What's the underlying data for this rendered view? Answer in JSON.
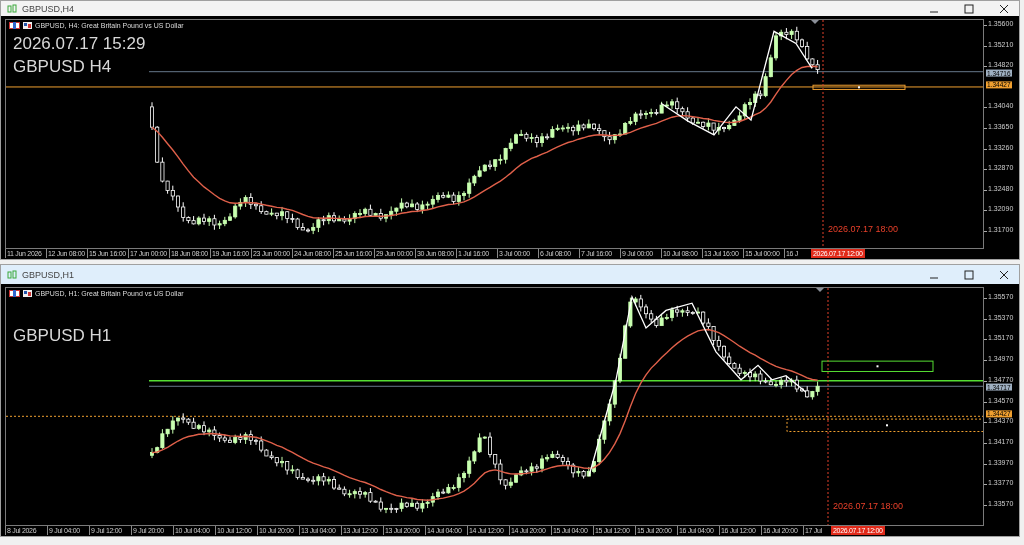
{
  "windows": [
    {
      "title": "GBPUSD,H4",
      "active": false,
      "header": "GBPUSD, H4: Great Britain Pound vs US Dollar",
      "overlay_texts": [
        "2026.07.17 15:29",
        "GBPUSD H4"
      ],
      "price_axis": [
        "1.35600",
        "1.35210",
        "1.34820",
        "1.34040",
        "1.33650",
        "1.33260",
        "1.32870",
        "1.32480",
        "1.32090",
        "1.31700"
      ],
      "price_tags": [
        {
          "text": "1.34716",
          "kind": "bid"
        },
        {
          "text": "1.34427",
          "kind": "level"
        }
      ],
      "time_axis": [
        "11 Jun 2026",
        "12 Jun 08:00",
        "15 Jun 16:00",
        "17 Jun 00:00",
        "18 Jun 08:00",
        "19 Jun 16:00",
        "23 Jun 00:00",
        "24 Jun 08:00",
        "25 Jun 16:00",
        "29 Jun 00:00",
        "30 Jun 08:00",
        "1 Jul 16:00",
        "3 Jul 00:00",
        "6 Jul 08:00",
        "7 Jul 16:00",
        "9 Jul 00:00",
        "10 Jul 08:00",
        "13 Jul 16:00",
        "15 Jul 00:00",
        "16 J"
      ],
      "time_tag": "2026.07.17 12:00",
      "cursor_label": "2026.07.17 18:00"
    },
    {
      "title": "GBPUSD,H1",
      "active": true,
      "header": "GBPUSD, H1: Great Britain Pound vs US Dollar",
      "overlay_texts": [
        "GBPUSD H1"
      ],
      "price_axis": [
        "1.35570",
        "1.35370",
        "1.35170",
        "1.34970",
        "1.34770",
        "1.34570",
        "1.34370",
        "1.34170",
        "1.33970",
        "1.33770",
        "1.33570"
      ],
      "price_tags": [
        {
          "text": "1.34717",
          "kind": "bid"
        },
        {
          "text": "1.34427",
          "kind": "level"
        }
      ],
      "time_axis": [
        "8 Jul 2026",
        "9 Jul 04:00",
        "9 Jul 12:00",
        "9 Jul 20:00",
        "10 Jul 04:00",
        "10 Jul 12:00",
        "10 Jul 20:00",
        "13 Jul 04:00",
        "13 Jul 12:00",
        "13 Jul 20:00",
        "14 Jul 04:00",
        "14 Jul 12:00",
        "14 Jul 20:00",
        "15 Jul 04:00",
        "15 Jul 12:00",
        "15 Jul 20:00",
        "16 Jul 04:00",
        "16 Jul 12:00",
        "16 Jul 20:00",
        "17 Jul"
      ],
      "time_tag": "2026.07.17 12:00",
      "cursor_label": "2026.07.17 18:00"
    }
  ]
}
